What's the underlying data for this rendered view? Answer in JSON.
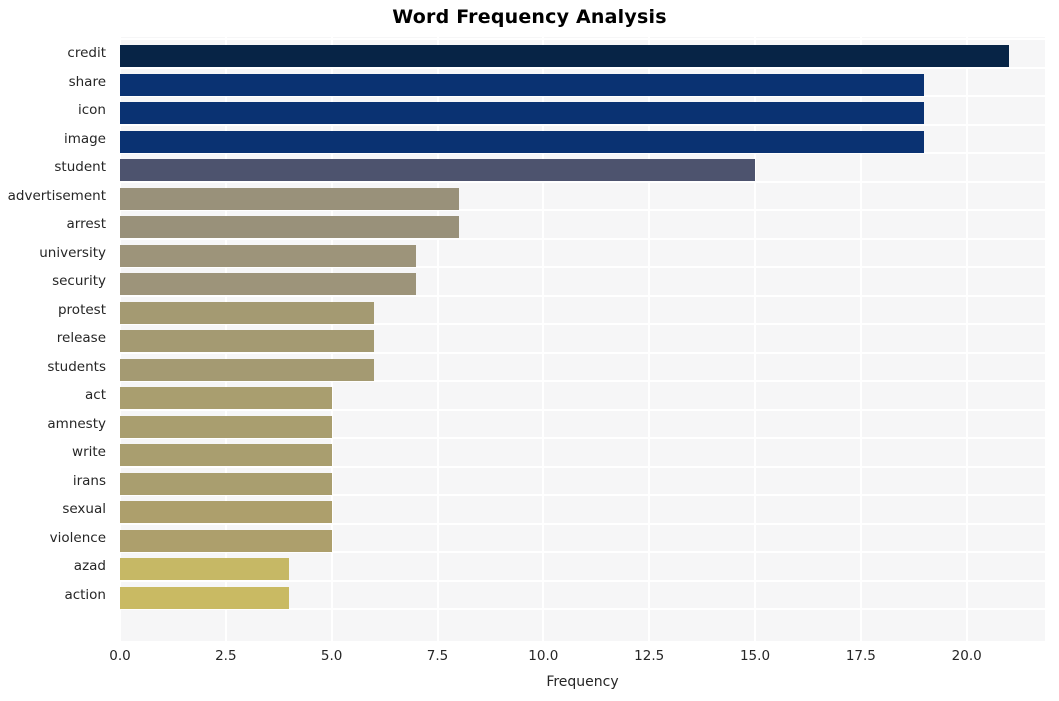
{
  "chart_data": {
    "type": "bar",
    "orientation": "horizontal",
    "title": "Word Frequency Analysis",
    "xlabel": "Frequency",
    "ylabel": "",
    "xlim": [
      0,
      21.85
    ],
    "xticks": [
      0.0,
      2.5,
      5.0,
      7.5,
      10.0,
      12.5,
      15.0,
      17.5,
      20.0
    ],
    "xticklabels": [
      "0.0",
      "2.5",
      "5.0",
      "7.5",
      "10.0",
      "12.5",
      "15.0",
      "17.5",
      "20.0"
    ],
    "grid": true,
    "legend": null,
    "categories": [
      "credit",
      "share",
      "icon",
      "image",
      "student",
      "advertisement",
      "arrest",
      "university",
      "security",
      "protest",
      "release",
      "students",
      "act",
      "amnesty",
      "write",
      "irans",
      "sexual",
      "violence",
      "azad",
      "action"
    ],
    "values": [
      21,
      19,
      19,
      19,
      15,
      8,
      8,
      7,
      7,
      6,
      6,
      6,
      5,
      5,
      5,
      5,
      5,
      5,
      4,
      4
    ],
    "bar_colors": [
      "#072446",
      "#0a3272",
      "#0a3272",
      "#0a3272",
      "#4d536e",
      "#99917a",
      "#99917a",
      "#9d947a",
      "#9d947a",
      "#a49a72",
      "#a49a72",
      "#a49a72",
      "#a99e6f",
      "#a99e6f",
      "#a99e6f",
      "#a99e6f",
      "#ad9f6c",
      "#ad9f6c",
      "#c6b865",
      "#c9ba63"
    ],
    "plot_background": "#f6f6f7",
    "grid_color": "#ffffff",
    "text_color": "#262626"
  }
}
